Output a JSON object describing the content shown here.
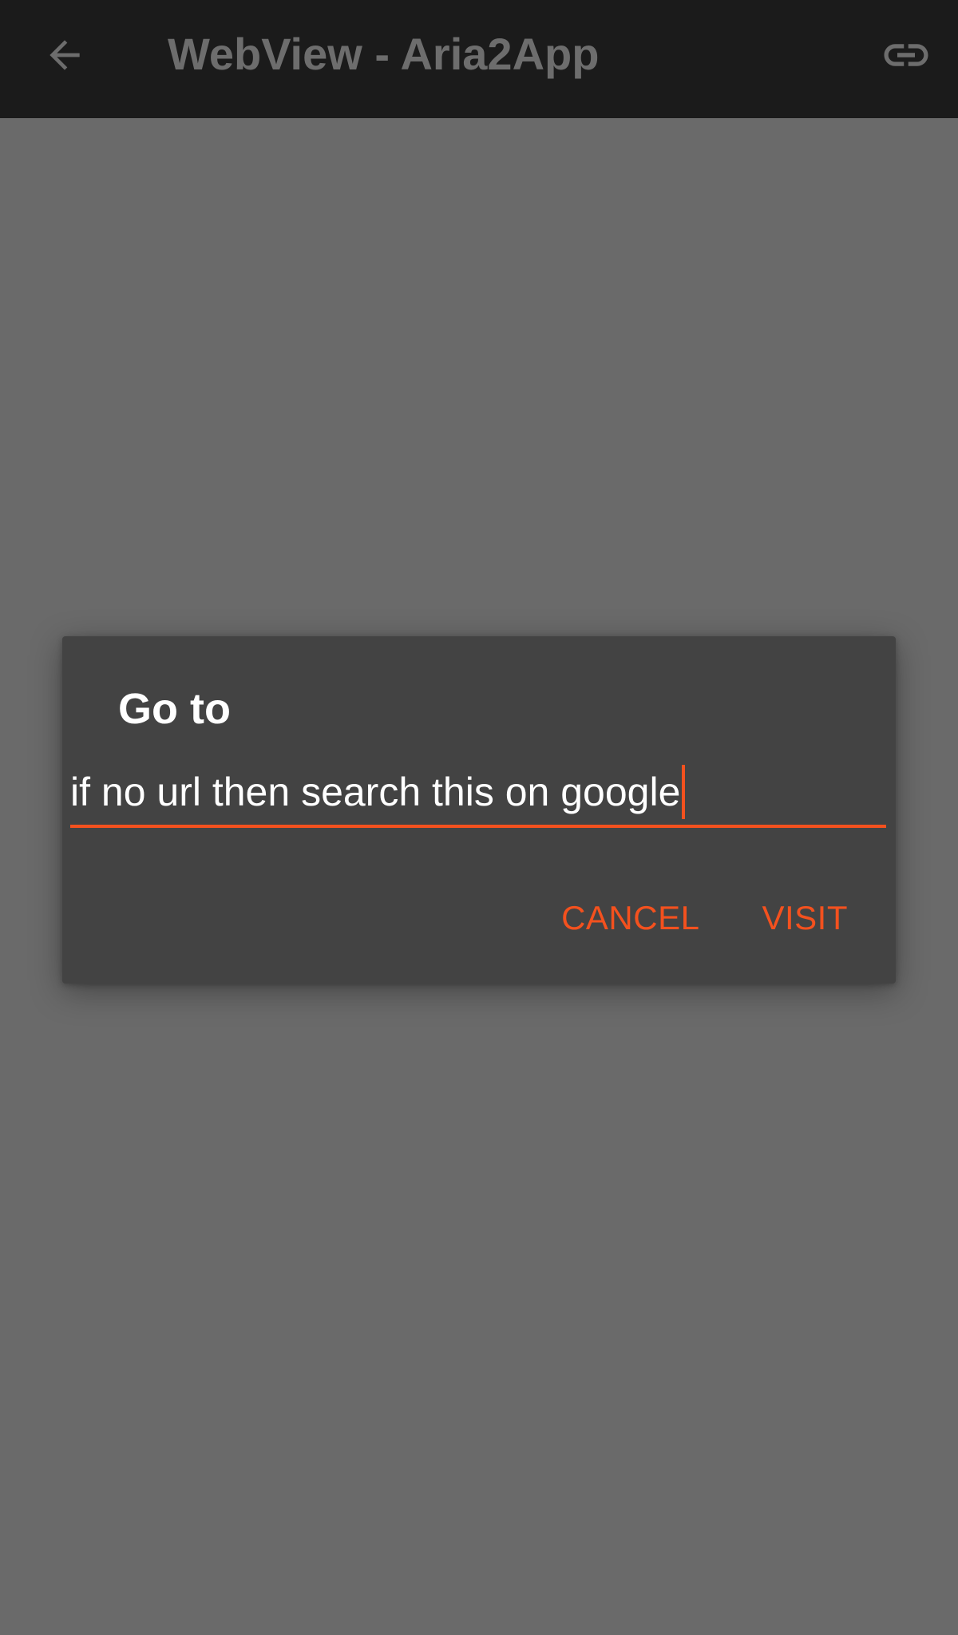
{
  "app_bar": {
    "back_icon": "arrow-left-icon",
    "title": "WebView - Aria2App",
    "link_icon": "link-icon"
  },
  "dialog": {
    "title": "Go to",
    "input_value": "if no url then search this on google",
    "cancel_label": "CANCEL",
    "visit_label": "VISIT"
  },
  "colors": {
    "accent": "#f4511e",
    "app_bar_bg": "#1b1b1b",
    "dialog_bg": "#434343",
    "scrim_bg": "#6a6a6a"
  }
}
